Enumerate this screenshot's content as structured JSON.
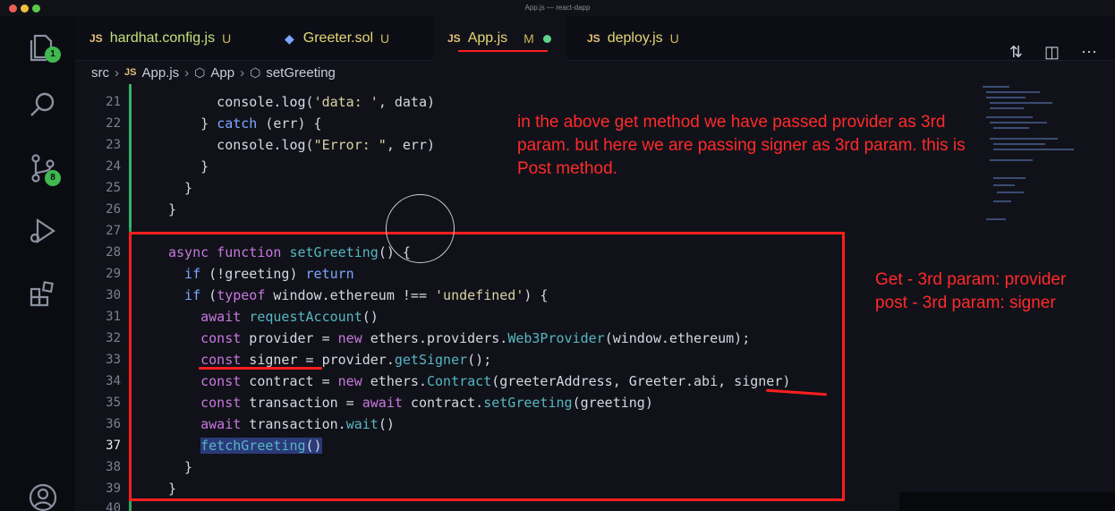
{
  "window": {
    "title": "App.js — react-dapp"
  },
  "activity_bar": {
    "explorer_badge": "1",
    "source_control_badge": "8"
  },
  "tabs": [
    {
      "icon": "JS",
      "label": "hardhat.config.js",
      "status": "U"
    },
    {
      "icon": "ethereum",
      "label": "Greeter.sol",
      "status": "U"
    },
    {
      "icon": "JS",
      "label": "App.js",
      "status": "M"
    },
    {
      "icon": "JS",
      "label": "deploy.js",
      "status": "U"
    }
  ],
  "breadcrumb": {
    "folder": "src",
    "file_icon": "JS",
    "file": "App.js",
    "component": "App",
    "function": "setGreeting"
  },
  "code": {
    "lines": [
      {
        "n": "21",
        "text": "      console.log('data: ', data)"
      },
      {
        "n": "22",
        "text": "    } catch (err) {"
      },
      {
        "n": "23",
        "text": "      console.log(\"Error: \", err)"
      },
      {
        "n": "24",
        "text": "    }"
      },
      {
        "n": "25",
        "text": "  }"
      },
      {
        "n": "26",
        "text": "}"
      },
      {
        "n": "27",
        "text": ""
      },
      {
        "n": "28",
        "text": "async function setGreeting() {"
      },
      {
        "n": "29",
        "text": "  if (!greeting) return"
      },
      {
        "n": "30",
        "text": "  if (typeof window.ethereum !== 'undefined') {"
      },
      {
        "n": "31",
        "text": "    await requestAccount()"
      },
      {
        "n": "32",
        "text": "    const provider = new ethers.providers.Web3Provider(window.ethereum);"
      },
      {
        "n": "33",
        "text": "    const signer = provider.getSigner();"
      },
      {
        "n": "34",
        "text": "    const contract = new ethers.Contract(greeterAddress, Greeter.abi, signer)"
      },
      {
        "n": "35",
        "text": "    const transaction = await contract.setGreeting(greeting)"
      },
      {
        "n": "36",
        "text": "    await transaction.wait()"
      },
      {
        "n": "37",
        "text": "    fetchGreeting()"
      },
      {
        "n": "38",
        "text": "  }"
      },
      {
        "n": "39",
        "text": "}"
      },
      {
        "n": "40",
        "text": ""
      }
    ]
  },
  "annotations": {
    "note_top": "in the above get method we have passed provider as 3rd param. but here we are passing signer as 3rd param. this is Post method.",
    "note_get": "Get - 3rd param: provider",
    "note_post": "post - 3rd param: signer",
    "color": "#ff1e1e"
  }
}
